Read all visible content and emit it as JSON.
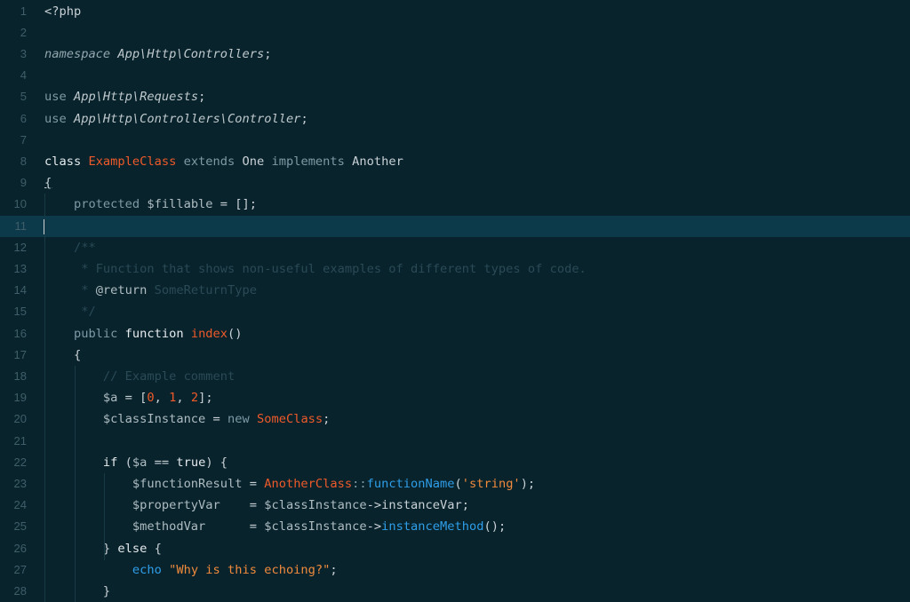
{
  "editor": {
    "current_line": 11,
    "lines": [
      {
        "n": "1",
        "segs": [
          {
            "t": "<?php",
            "c": "plain"
          }
        ]
      },
      {
        "n": "2",
        "segs": []
      },
      {
        "n": "3",
        "segs": [
          {
            "t": "namespace ",
            "c": "ns"
          },
          {
            "t": "App\\Http\\Controllers",
            "c": "nsi"
          },
          {
            "t": ";",
            "c": "plain"
          }
        ]
      },
      {
        "n": "4",
        "segs": []
      },
      {
        "n": "5",
        "segs": [
          {
            "t": "use ",
            "c": "muted"
          },
          {
            "t": "App\\Http\\Requests",
            "c": "nsi"
          },
          {
            "t": ";",
            "c": "plain"
          }
        ]
      },
      {
        "n": "6",
        "segs": [
          {
            "t": "use ",
            "c": "muted"
          },
          {
            "t": "App\\Http\\Controllers\\Controller",
            "c": "nsi"
          },
          {
            "t": ";",
            "c": "plain"
          }
        ]
      },
      {
        "n": "7",
        "segs": []
      },
      {
        "n": "8",
        "segs": [
          {
            "t": "class ",
            "c": "kw"
          },
          {
            "t": "ExampleClass",
            "c": "cls"
          },
          {
            "t": " extends ",
            "c": "muted"
          },
          {
            "t": "One",
            "c": "plain"
          },
          {
            "t": " implements ",
            "c": "muted"
          },
          {
            "t": "Another",
            "c": "plain"
          }
        ]
      },
      {
        "n": "9",
        "segs": [
          {
            "t": "{",
            "c": "brace-u"
          }
        ]
      },
      {
        "n": "10",
        "segs": [
          {
            "t": "    protected ",
            "c": "muted"
          },
          {
            "t": "$fillable",
            "c": "var"
          },
          {
            "t": " = [];",
            "c": "plain"
          }
        ]
      },
      {
        "n": "11",
        "segs": []
      },
      {
        "n": "12",
        "segs": [
          {
            "t": "    /**",
            "c": "cmt"
          }
        ]
      },
      {
        "n": "13",
        "segs": [
          {
            "t": "     * Function that shows non-useful examples of different types of code.",
            "c": "cmt"
          }
        ]
      },
      {
        "n": "14",
        "segs": [
          {
            "t": "     * ",
            "c": "cmt"
          },
          {
            "t": "@return",
            "c": "doc"
          },
          {
            "t": " SomeReturnType",
            "c": "cmt"
          }
        ]
      },
      {
        "n": "15",
        "segs": [
          {
            "t": "     */",
            "c": "cmt"
          }
        ]
      },
      {
        "n": "16",
        "segs": [
          {
            "t": "    public ",
            "c": "muted"
          },
          {
            "t": "function ",
            "c": "kw"
          },
          {
            "t": "index",
            "c": "fn"
          },
          {
            "t": "()",
            "c": "plain"
          }
        ]
      },
      {
        "n": "17",
        "segs": [
          {
            "t": "    {",
            "c": "plain"
          }
        ]
      },
      {
        "n": "18",
        "segs": [
          {
            "t": "        // Example comment",
            "c": "cmt"
          }
        ]
      },
      {
        "n": "19",
        "segs": [
          {
            "t": "        $a",
            "c": "var"
          },
          {
            "t": " = [",
            "c": "plain"
          },
          {
            "t": "0",
            "c": "num"
          },
          {
            "t": ", ",
            "c": "plain"
          },
          {
            "t": "1",
            "c": "num"
          },
          {
            "t": ", ",
            "c": "plain"
          },
          {
            "t": "2",
            "c": "num"
          },
          {
            "t": "];",
            "c": "plain"
          }
        ]
      },
      {
        "n": "20",
        "segs": [
          {
            "t": "        $classInstance",
            "c": "var"
          },
          {
            "t": " = ",
            "c": "plain"
          },
          {
            "t": "new ",
            "c": "muted"
          },
          {
            "t": "SomeClass",
            "c": "cls"
          },
          {
            "t": ";",
            "c": "plain"
          }
        ]
      },
      {
        "n": "21",
        "segs": []
      },
      {
        "n": "22",
        "segs": [
          {
            "t": "        if ",
            "c": "kw"
          },
          {
            "t": "(",
            "c": "plain"
          },
          {
            "t": "$a",
            "c": "var"
          },
          {
            "t": " == ",
            "c": "plain"
          },
          {
            "t": "true",
            "c": "kw"
          },
          {
            "t": ") {",
            "c": "plain"
          }
        ]
      },
      {
        "n": "23",
        "segs": [
          {
            "t": "            $functionResult",
            "c": "var"
          },
          {
            "t": " = ",
            "c": "plain"
          },
          {
            "t": "AnotherClass",
            "c": "cls"
          },
          {
            "t": "::",
            "c": "muted"
          },
          {
            "t": "functionName",
            "c": "call"
          },
          {
            "t": "(",
            "c": "plain"
          },
          {
            "t": "'string'",
            "c": "str"
          },
          {
            "t": ");",
            "c": "plain"
          }
        ]
      },
      {
        "n": "24",
        "segs": [
          {
            "t": "            $propertyVar",
            "c": "var"
          },
          {
            "t": "    = ",
            "c": "plain"
          },
          {
            "t": "$classInstance",
            "c": "var"
          },
          {
            "t": "->",
            "c": "plain"
          },
          {
            "t": "instanceVar",
            "c": "plain"
          },
          {
            "t": ";",
            "c": "plain"
          }
        ]
      },
      {
        "n": "25",
        "segs": [
          {
            "t": "            $methodVar",
            "c": "var"
          },
          {
            "t": "      = ",
            "c": "plain"
          },
          {
            "t": "$classInstance",
            "c": "var"
          },
          {
            "t": "->",
            "c": "plain"
          },
          {
            "t": "instanceMethod",
            "c": "call"
          },
          {
            "t": "();",
            "c": "plain"
          }
        ]
      },
      {
        "n": "26",
        "segs": [
          {
            "t": "        } ",
            "c": "plain"
          },
          {
            "t": "else",
            "c": "kw"
          },
          {
            "t": " {",
            "c": "plain"
          }
        ]
      },
      {
        "n": "27",
        "segs": [
          {
            "t": "            ",
            "c": "plain"
          },
          {
            "t": "echo ",
            "c": "call"
          },
          {
            "t": "\"Why is this echoing?\"",
            "c": "str"
          },
          {
            "t": ";",
            "c": "plain"
          }
        ]
      },
      {
        "n": "28",
        "segs": [
          {
            "t": "        }",
            "c": "plain"
          }
        ]
      }
    ]
  }
}
